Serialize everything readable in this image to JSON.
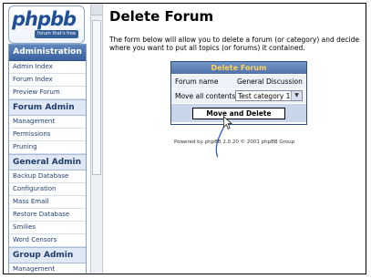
{
  "logo": {
    "word": "phpbb",
    "tagline": "forum that's free"
  },
  "sidebar": {
    "header": "Administration",
    "sections": [
      {
        "title": "",
        "items": [
          "Admin Index",
          "Forum Index",
          "Preview Forum"
        ]
      },
      {
        "title": "Forum Admin",
        "items": [
          "Management",
          "Permissions",
          "Pruning"
        ]
      },
      {
        "title": "General Admin",
        "items": [
          "Backup Database",
          "Configuration",
          "Mass Email",
          "Restore Database",
          "Smilies",
          "Word Censors"
        ]
      },
      {
        "title": "Group Admin",
        "items": [
          "Management"
        ]
      }
    ]
  },
  "main": {
    "title": "Delete Forum",
    "description": "The form below will allow you to delete a forum (or category) and decide where you want to put all topics (or forums) it contained.",
    "panel": {
      "header": "Delete Forum",
      "rows": [
        {
          "label": "Forum name",
          "value": "General Discussion"
        },
        {
          "label": "Move all contents",
          "value": "Test category 1"
        }
      ],
      "button": "Move and Delete"
    },
    "footer": "Powered by phpBB 2.0.20 © 2001 phpBB Group"
  },
  "colors": {
    "accent": "#3b62a0",
    "panel_header_text": "#ffd45e",
    "annotation": "#1f4fd1"
  }
}
